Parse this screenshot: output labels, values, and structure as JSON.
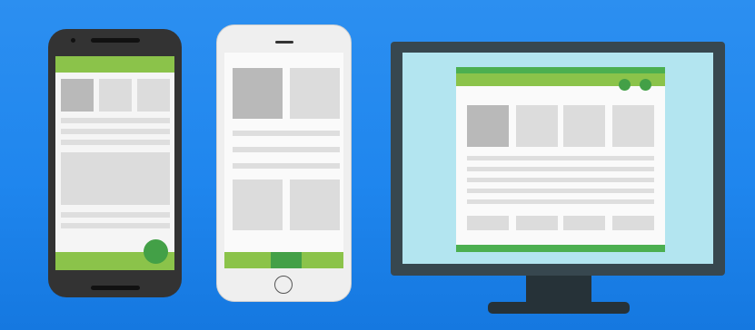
{
  "illustration": {
    "devices": [
      {
        "kind": "android-phone",
        "body_color": "#333333"
      },
      {
        "kind": "iphone",
        "body_color": "#efefef"
      },
      {
        "kind": "desktop-monitor",
        "body_color": "#37474f"
      }
    ]
  },
  "colors": {
    "background": "#1f86ee",
    "accent_green": "#8bc34a",
    "accent_dark_green": "#4caf50",
    "fab_green": "#43a047",
    "placeholder_light": "#dcdcdc",
    "placeholder_dark": "#b9b9b9",
    "monitor_screen": "#b3e5f0"
  },
  "icons": [
    "fab-circle-icon",
    "home-button-icon",
    "window-control-dot-icon"
  ]
}
